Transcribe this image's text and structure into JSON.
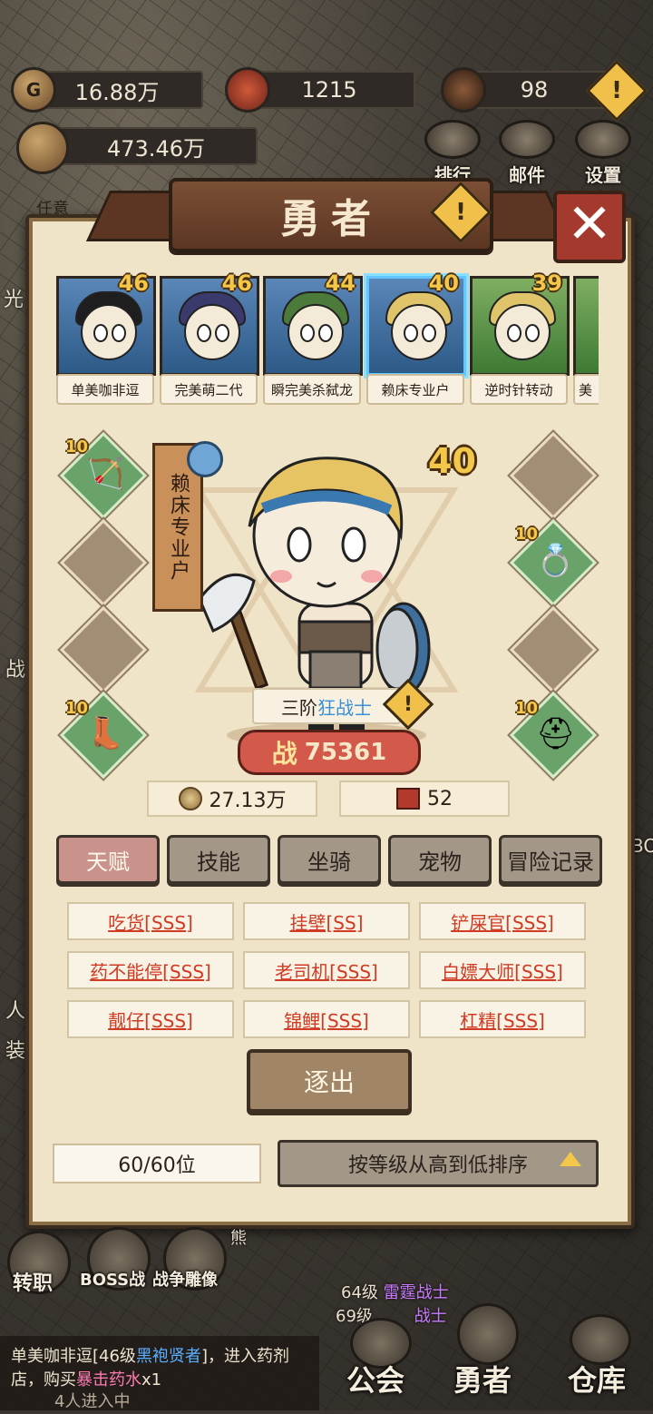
{
  "resources": {
    "gold": "16.88万",
    "badge": "1215",
    "gem": "98",
    "power_total": "473.46万"
  },
  "top_buttons": {
    "rank_label": "排行",
    "mail_label": "邮件",
    "settings_label": "设置"
  },
  "left_side_fragments": [
    "任意",
    "光",
    "战",
    "人",
    "装"
  ],
  "right_side_fragments": [
    "BO"
  ],
  "dialog": {
    "title": "勇者",
    "close_label": "✕"
  },
  "heroes": [
    {
      "name": "单美咖非逗",
      "level": "46"
    },
    {
      "name": "完美萌二代",
      "level": "46"
    },
    {
      "name": "瞬完美杀弑龙",
      "level": "44"
    },
    {
      "name": "赖床专业户",
      "level": "40"
    },
    {
      "name": "逆时针转动",
      "level": "39"
    },
    {
      "name": "美",
      "level": ""
    }
  ],
  "selected_hero": {
    "name": "赖床专业户",
    "level": "40",
    "class_prefix": "三阶",
    "class_name": "狂战士",
    "power_label": "战",
    "power": "75361",
    "gold_value": "27.13万",
    "book_value": "52"
  },
  "equipment": {
    "left": [
      {
        "level": "10",
        "item": "weapon-crossbow-icon"
      },
      {
        "level": "",
        "item": ""
      },
      {
        "level": "",
        "item": ""
      },
      {
        "level": "10",
        "item": "boots-icon"
      }
    ],
    "right": [
      {
        "level": "",
        "item": ""
      },
      {
        "level": "10",
        "item": "ring-icon"
      },
      {
        "level": "",
        "item": ""
      },
      {
        "level": "10",
        "item": "helmet-icon"
      }
    ]
  },
  "tabs": [
    "天赋",
    "技能",
    "坐骑",
    "宠物",
    "冒险记录"
  ],
  "active_tab": "天赋",
  "talents": [
    "吃货[SSS]",
    "挂壁[SS]",
    "铲屎官[SSS]",
    "药不能停[SSS]",
    "老司机[SSS]",
    "白嫖大师[SSS]",
    "靓仔[SSS]",
    "锦鲤[SSS]",
    "杠精[SSS]"
  ],
  "expel_label": "逐出",
  "hero_count": "60/60位",
  "sort_label": "按等级从高到低排序",
  "bottom": {
    "job_label": "转职",
    "boss_label": "BOSS战",
    "statue_label": "战争雕像",
    "bear_label": "熊",
    "feed_line1_level": "64级",
    "feed_line1_class": "雷霆战士",
    "feed_line2_level": "69级",
    "feed_line2_class": "战士",
    "guild_label": "公会",
    "hero_label": "勇者",
    "warehouse_label": "仓库",
    "chat_prefix": "单美咖非逗[46级",
    "chat_class": "黑袍贤者",
    "chat_mid": "]，进入药剂店，购买",
    "chat_item": "暴击药水",
    "chat_suffix": "x1",
    "chat_tail": "4人进入中"
  },
  "colors": {
    "panel_bg": "#efe3c8",
    "title_bg": "#6b4230",
    "talent_text": "#d13b24",
    "class_text": "#3a8fd6",
    "level_gold": "#f3c84a",
    "active_tab": "#c9928a"
  }
}
